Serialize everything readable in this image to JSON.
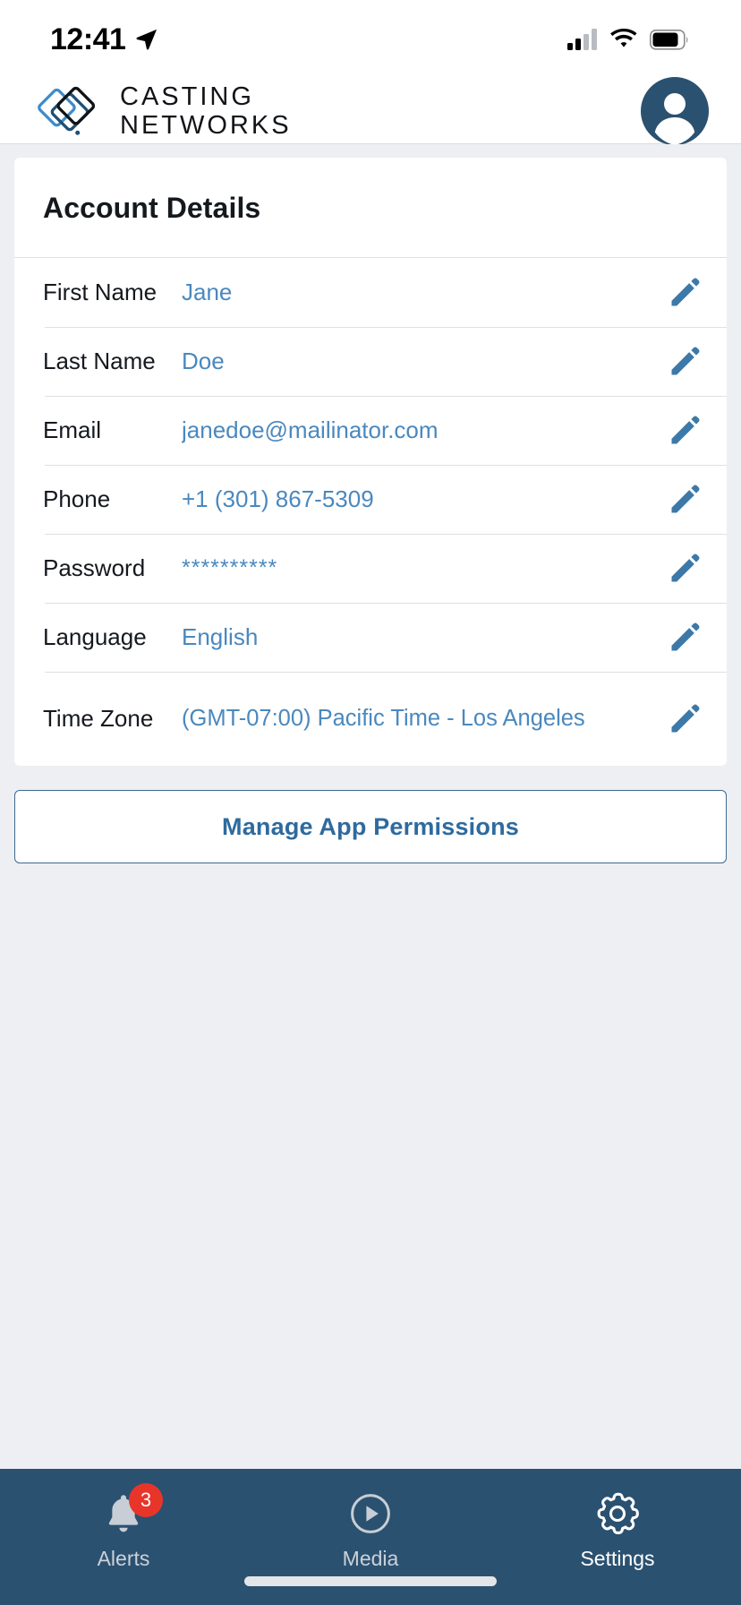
{
  "status_bar": {
    "time": "12:41",
    "location_icon": "location-arrow-icon",
    "cellular_icon": "cellular-signal-icon",
    "wifi_icon": "wifi-icon",
    "battery_icon": "battery-icon"
  },
  "header": {
    "logo_icon": "casting-networks-logo-icon",
    "brand_line1": "CASTING",
    "brand_line2": "NETWORKS",
    "avatar_icon": "user-avatar-icon"
  },
  "account": {
    "card_title": "Account Details",
    "edit_icon": "pencil-edit-icon",
    "rows": [
      {
        "label": "First Name",
        "value": "Jane"
      },
      {
        "label": "Last Name",
        "value": "Doe"
      },
      {
        "label": "Email",
        "value": "janedoe@mailinator.com"
      },
      {
        "label": "Phone",
        "value": "+1 (301) 867-5309"
      },
      {
        "label": "Password",
        "value": "**********"
      },
      {
        "label": "Language",
        "value": "English"
      },
      {
        "label": "Time Zone",
        "value": "(GMT-07:00) Pacific Time - Los Angeles"
      }
    ]
  },
  "permissions_button": {
    "label": "Manage App Permissions"
  },
  "tabbar": {
    "items": [
      {
        "label": "Alerts",
        "icon": "bell-icon",
        "badge": "3",
        "active": false
      },
      {
        "label": "Media",
        "icon": "play-circle-icon",
        "badge": "",
        "active": false
      },
      {
        "label": "Settings",
        "icon": "gear-icon",
        "badge": "",
        "active": true
      }
    ]
  },
  "colors": {
    "accent_blue": "#4A88BE",
    "link_blue": "#2E6A9E",
    "tabbar_navy": "#2B5170",
    "badge_red": "#E8352A",
    "page_bg": "#EDEFF3"
  }
}
